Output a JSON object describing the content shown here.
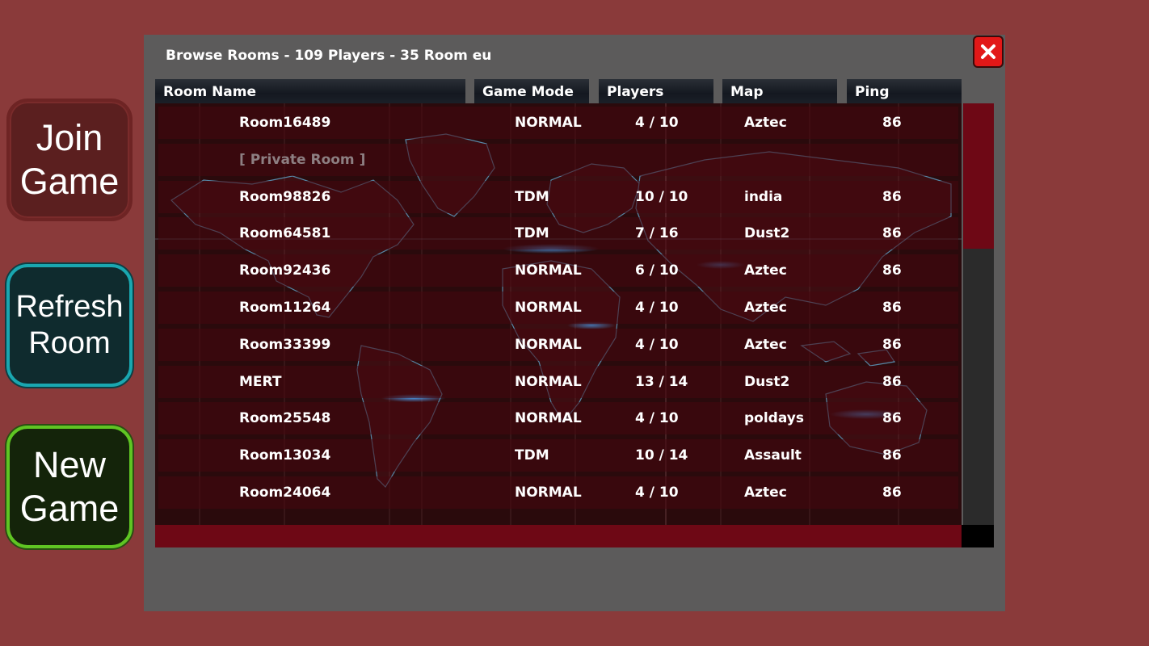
{
  "side_buttons": {
    "join": [
      "Join",
      "Game"
    ],
    "refresh": [
      "Refresh",
      "Room"
    ],
    "new": [
      "New",
      "Game"
    ]
  },
  "panel": {
    "title": "Browse Rooms - 109 Players - 35 Room eu",
    "close_icon": "close-x-icon"
  },
  "columns": {
    "room_name": "Room Name",
    "game_mode": "Game Mode",
    "players": "Players",
    "map": "Map",
    "ping": "Ping"
  },
  "rows": [
    {
      "name": "Room16489",
      "mode": "NORMAL",
      "players": "4 / 10",
      "map": "Aztec",
      "ping": "86"
    },
    {
      "name": "[  Private Room  ]",
      "mode": "",
      "players": "",
      "map": "",
      "ping": "",
      "private": true
    },
    {
      "name": "Room98826",
      "mode": "TDM",
      "players": "10 / 10",
      "map": "india",
      "ping": "86"
    },
    {
      "name": "Room64581",
      "mode": "TDM",
      "players": "7 / 16",
      "map": "Dust2",
      "ping": "86"
    },
    {
      "name": "Room92436",
      "mode": "NORMAL",
      "players": "6 / 10",
      "map": "Aztec",
      "ping": "86"
    },
    {
      "name": "Room11264",
      "mode": "NORMAL",
      "players": "4 / 10",
      "map": "Aztec",
      "ping": "86"
    },
    {
      "name": "Room33399",
      "mode": "NORMAL",
      "players": "4 / 10",
      "map": "Aztec",
      "ping": "86"
    },
    {
      "name": "MERT",
      "mode": "NORMAL",
      "players": "13 / 14",
      "map": "Dust2",
      "ping": "86"
    },
    {
      "name": "Room25548",
      "mode": "NORMAL",
      "players": "4 / 10",
      "map": "poldays",
      "ping": "86"
    },
    {
      "name": "Room13034",
      "mode": "TDM",
      "players": "10 / 14",
      "map": "Assault",
      "ping": "86"
    },
    {
      "name": "Room24064",
      "mode": "NORMAL",
      "players": "4 / 10",
      "map": "Aztec",
      "ping": "86"
    }
  ],
  "colors": {
    "background": "#8a3a3a",
    "panel": "#5c5b5b",
    "scroll_accent": "#6e0815",
    "close": "#e21818"
  }
}
